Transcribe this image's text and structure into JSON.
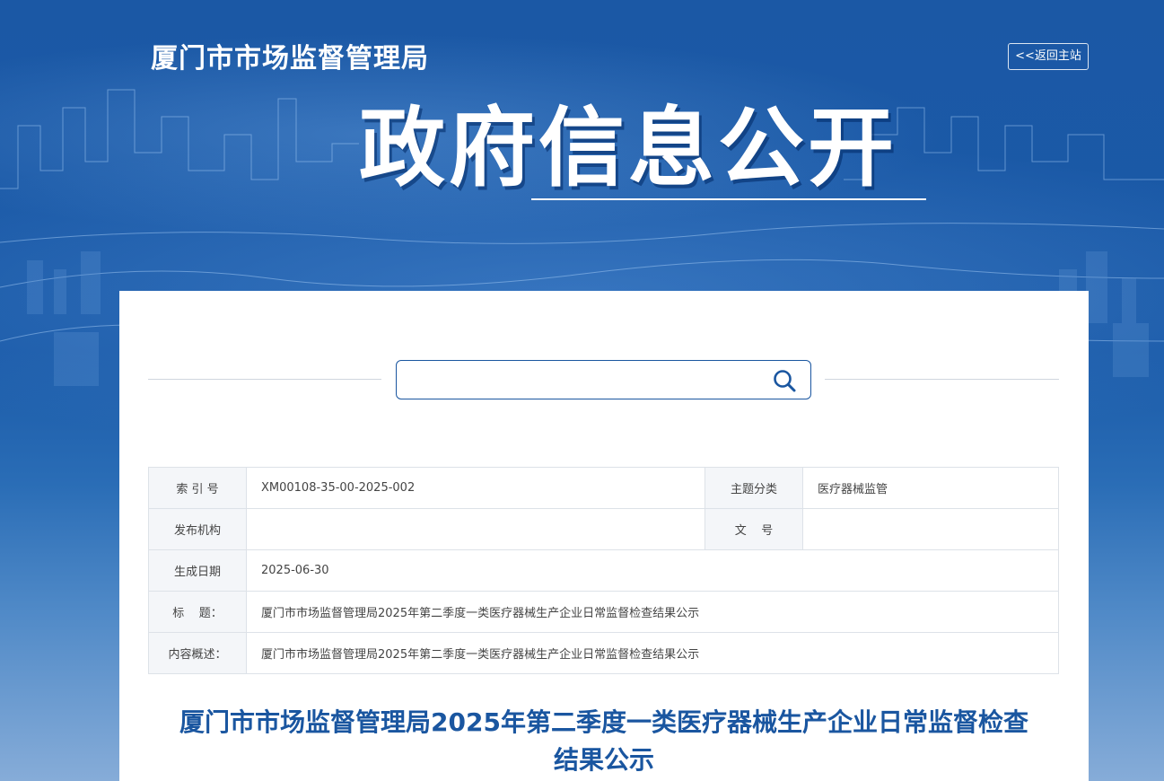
{
  "header": {
    "site_name": "厦门市市场监督管理局",
    "back_label": "<<返回主站",
    "hero_title": "政府信息公开"
  },
  "search": {
    "placeholder": ""
  },
  "meta": {
    "index_label": "索 引 号",
    "index_value": "XM00108-35-00-2025-002",
    "topic_label": "主题分类",
    "topic_value": "医疗器械监管",
    "publisher_label": "发布机构",
    "publisher_value": "",
    "doc_no_label": "文    号",
    "doc_no_value": "",
    "date_label": "生成日期",
    "date_value": "2025-06-30",
    "title_label": "标    题：",
    "title_value": "厦门市市场监督管理局2025年第二季度一类医疗器械生产企业日常监督检查结果公示",
    "summary_label": "内容概述：",
    "summary_value": "厦门市市场监督管理局2025年第二季度一类医疗器械生产企业日常监督检查结果公示"
  },
  "article": {
    "title": "厦门市市场监督管理局2025年第二季度一类医疗器械生产企业日常监督检查结果公示"
  },
  "colors": {
    "brand": "#1a56a0",
    "label_bg": "#f4f6f9",
    "border": "#dde2e8"
  }
}
